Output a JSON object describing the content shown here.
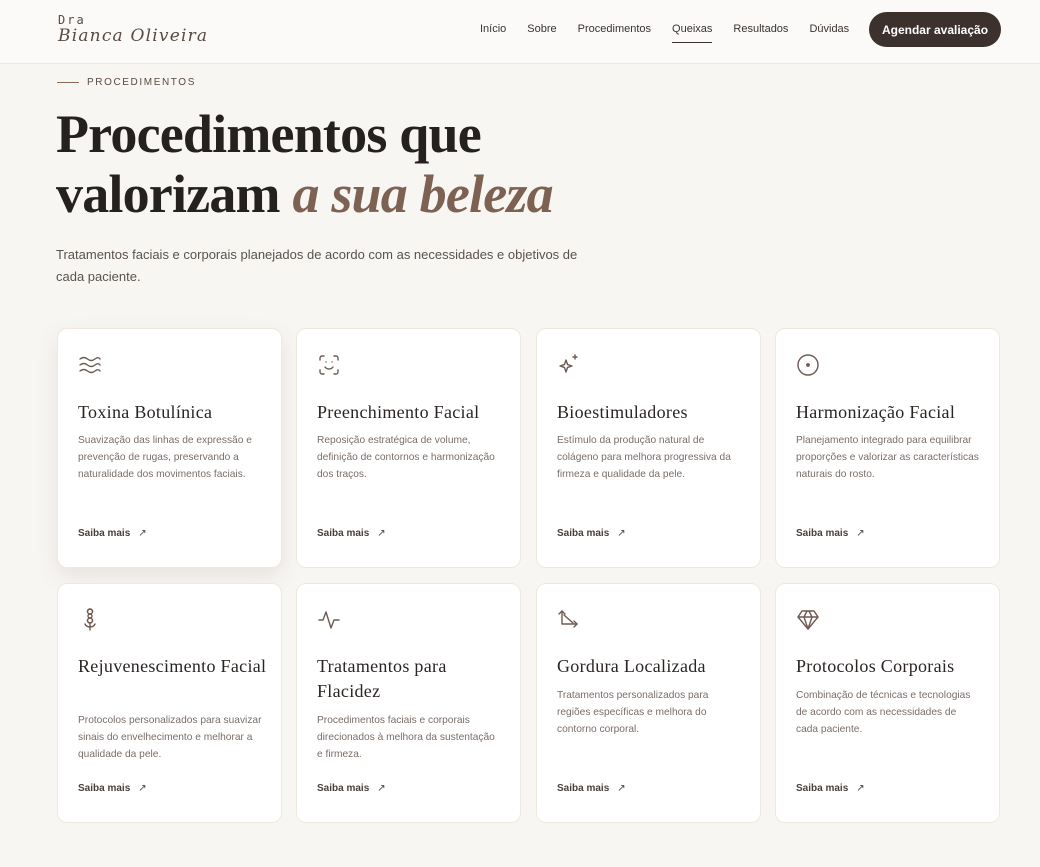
{
  "header": {
    "logo_small": "Dra",
    "logo_name": "Bianca Oliveira",
    "nav": [
      "Início",
      "Sobre",
      "Procedimentos",
      "Queixas",
      "Resultados",
      "Dúvidas"
    ],
    "active_nav": "Queixas",
    "cta_label": "Agendar avaliação"
  },
  "intro": {
    "eyebrow": "PROCEDIMENTOS",
    "title_line1": "Procedimentos que",
    "title_line2_plain": "valorizam ",
    "title_line2_accent": "a sua beleza",
    "lead": "Tratamentos faciais e corporais planejados de acordo com as necessidades e objetivos de cada paciente."
  },
  "cards": [
    {
      "icon": "waves-icon",
      "title": "Toxina Botulínica",
      "desc": "Suavização das linhas de expressão e prevenção de rugas, preservando a naturalidade dos movimentos faciais.",
      "link": "Saiba mais",
      "arrow": "↗"
    },
    {
      "icon": "face-scan-icon",
      "title": "Preenchimento Facial",
      "desc": "Reposição estratégica de volume, definição de contornos e harmonização dos traços.",
      "link": "Saiba mais",
      "arrow": "↗"
    },
    {
      "icon": "sparkles-icon",
      "title": "Bioestimuladores",
      "desc": "Estímulo da produção natural de colágeno para melhora progressiva da firmeza e qualidade da pele.",
      "link": "Saiba mais",
      "arrow": "↗"
    },
    {
      "icon": "circle-dot-icon",
      "title": "Harmonização Facial",
      "desc": "Planejamento integrado para equilibrar proporções e valorizar as características naturais do rosto.",
      "link": "Saiba mais",
      "arrow": "↗"
    },
    {
      "icon": "flower-icon",
      "title": "Rejuvenescimento Facial",
      "desc": "Protocolos personalizados para suavizar sinais do envelhecimento e melhorar a qualidade da pele.",
      "link": "Saiba mais",
      "arrow": "↗"
    },
    {
      "icon": "activity-icon",
      "title": "Tratamentos para Flacidez",
      "desc": "Procedimentos faciais e corporais direcionados à melhora da sustentação e firmeza.",
      "link": "Saiba mais",
      "arrow": "↗"
    },
    {
      "icon": "move-arrows-icon",
      "title": "Gordura Localizada",
      "desc": "Tratamentos personalizados para regiões específicas e melhora do contorno corporal.",
      "link": "Saiba mais",
      "arrow": "↗"
    },
    {
      "icon": "gem-icon",
      "title": "Protocolos Corporais",
      "desc": "Combinação de técnicas e tecnologias de acordo com as necessidades de cada paciente.",
      "link": "Saiba mais",
      "arrow": "↗"
    }
  ]
}
